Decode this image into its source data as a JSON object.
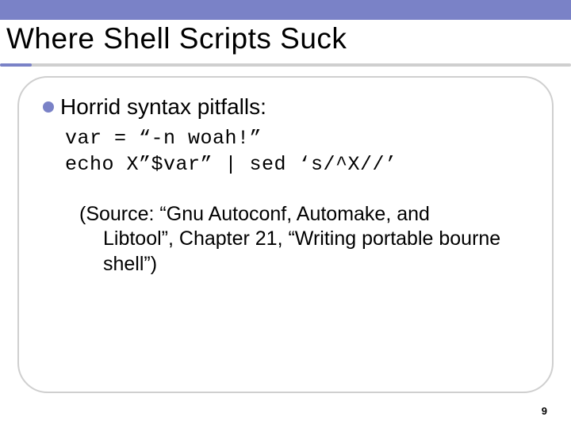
{
  "title": "Where Shell Scripts Suck",
  "bullet_label": "Horrid syntax pitfalls:",
  "code_line_1": "var = “-n woah!”",
  "code_line_2": "echo X”$var” | sed ‘s/^X//’",
  "source_text": "(Source: “Gnu Autoconf, Automake, and Libtool”, Chapter 21, “Writing portable bourne shell”)",
  "page_number": "9"
}
